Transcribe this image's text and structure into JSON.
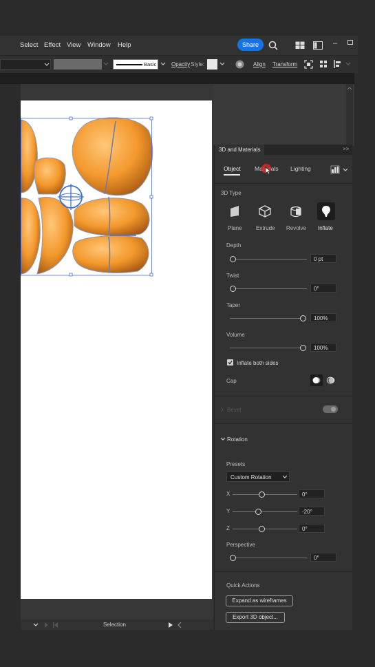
{
  "menu": {
    "items": [
      "Select",
      "Effect",
      "View",
      "Window",
      "Help"
    ],
    "share_label": "Share"
  },
  "control_bar": {
    "stroke_style": "Basic",
    "opacity_label": "Opacity",
    "style_label": "Style:",
    "align_label": "Align",
    "transform_label": "Transform"
  },
  "panel": {
    "title": "3D and Materials",
    "tabs": [
      "Object",
      "Materials",
      "Lighting"
    ],
    "active_tab": "Object",
    "section_3d_type": "3D Type",
    "types": [
      "Plane",
      "Extrude",
      "Revolve",
      "Inflate"
    ],
    "active_type": "Inflate",
    "depth": {
      "label": "Depth",
      "value": "0 pt",
      "level": 0
    },
    "twist": {
      "label": "Twist",
      "value": "0°",
      "level": 0
    },
    "taper": {
      "label": "Taper",
      "value": "100%",
      "level": 1
    },
    "volume": {
      "label": "Volume",
      "value": "100%",
      "level": 1
    },
    "inflate_both_sides": {
      "label": "Inflate both sides",
      "checked": true
    },
    "cap_label": "Cap",
    "bevel_label": "Bevel",
    "rotation": {
      "label": "Rotation",
      "presets_label": "Presets",
      "preset_value": "Custom Rotation",
      "x": {
        "label": "X",
        "value": "0°"
      },
      "y": {
        "label": "Y",
        "value": "-20°"
      },
      "z": {
        "label": "Z",
        "value": "0°"
      },
      "perspective": {
        "label": "Perspective",
        "value": "0°"
      }
    },
    "quick_actions": {
      "label": "Quick Actions",
      "expand_label": "Expand as wireframes",
      "export_label": "Export 3D object..."
    }
  },
  "status": {
    "tool": "Selection"
  },
  "colors": {
    "accent": "#1473e6",
    "artwork": "#f39a2e"
  }
}
